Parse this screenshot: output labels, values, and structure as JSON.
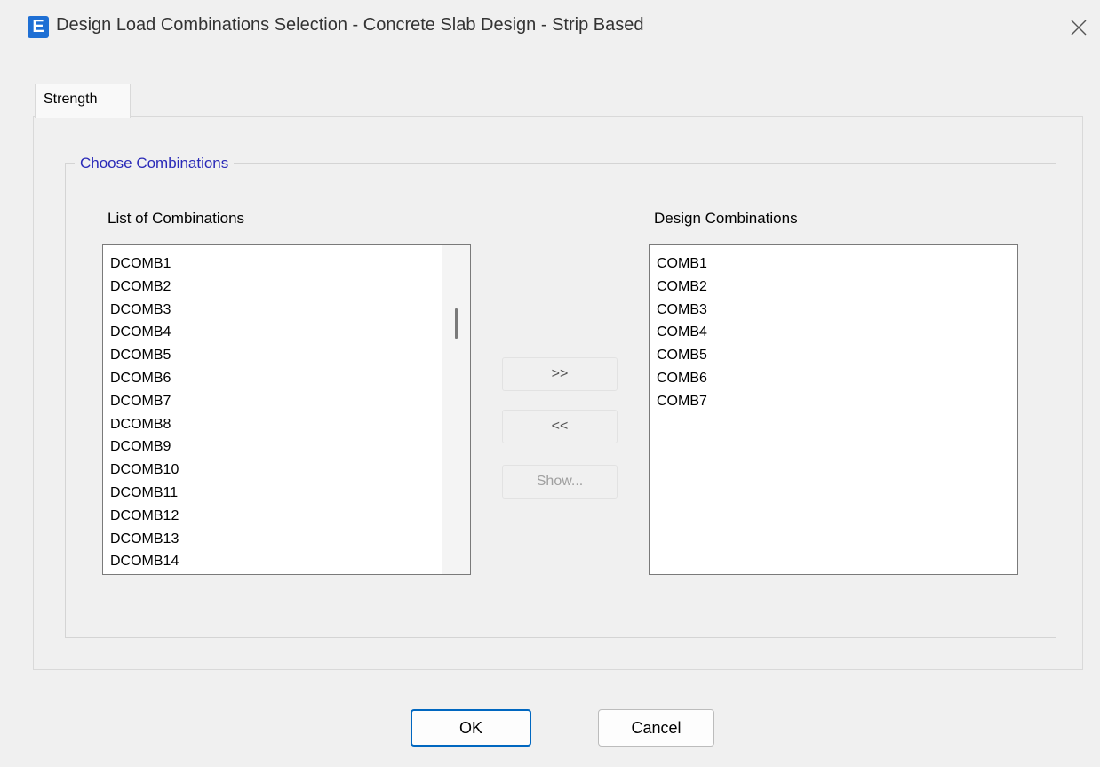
{
  "window": {
    "icon_letter": "E",
    "title": "Design Load Combinations Selection - Concrete Slab Design - Strip Based",
    "close_glyph": "×"
  },
  "icons": {
    "app": "etabs-app-icon",
    "close": "close-icon"
  },
  "tabs": [
    {
      "label": "Strength",
      "selected": true
    }
  ],
  "group": {
    "title": "Choose Combinations"
  },
  "left_list": {
    "label": "List of Combinations",
    "items": [
      "DCOMB1",
      "DCOMB2",
      "DCOMB3",
      "DCOMB4",
      "DCOMB5",
      "DCOMB6",
      "DCOMB7",
      "DCOMB8",
      "DCOMB9",
      "DCOMB10",
      "DCOMB11",
      "DCOMB12",
      "DCOMB13",
      "DCOMB14"
    ]
  },
  "right_list": {
    "label": "Design Combinations",
    "items": [
      "COMB1",
      "COMB2",
      "COMB3",
      "COMB4",
      "COMB5",
      "COMB6",
      "COMB7"
    ]
  },
  "buttons": {
    "add": ">>",
    "remove": "<<",
    "show": "Show...",
    "ok": "OK",
    "cancel": "Cancel"
  },
  "colors": {
    "accent": "#0067c0",
    "group_title": "#2a2ab8",
    "app_icon": "#1e6fd4"
  }
}
